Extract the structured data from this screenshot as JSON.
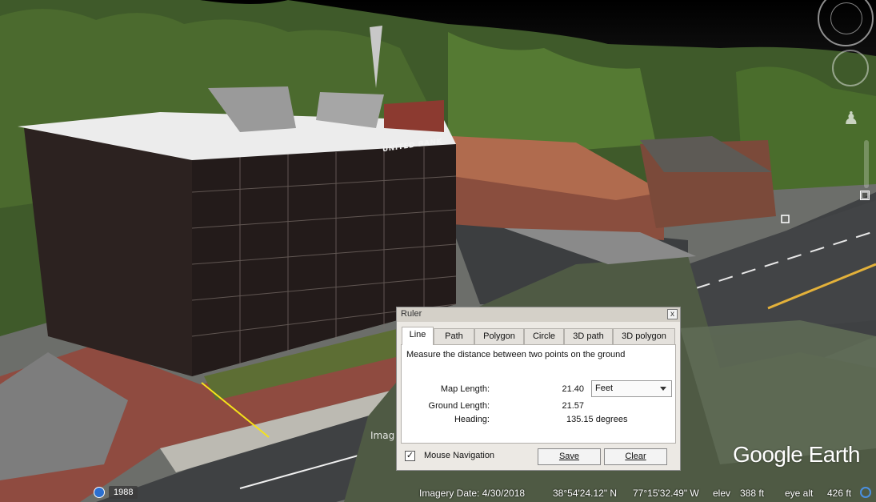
{
  "scene": {
    "building_sign": "UNITED BANK",
    "image_watermark": "Imag"
  },
  "branding": {
    "logo_text": "Google Earth"
  },
  "status_bar": {
    "year": "1988",
    "imagery_date": "Imagery Date: 4/30/2018",
    "latitude": "38°54'24.12\" N",
    "longitude": "77°15'32.49\" W",
    "elev_label": "elev",
    "elev_value": "388 ft",
    "eye_alt_label": "eye alt",
    "eye_alt_value": "426 ft"
  },
  "ruler": {
    "title": "Ruler",
    "close_label": "x",
    "tabs": [
      {
        "label": "Line",
        "active": true
      },
      {
        "label": "Path"
      },
      {
        "label": "Polygon"
      },
      {
        "label": "Circle"
      },
      {
        "label": "3D path"
      },
      {
        "label": "3D polygon"
      }
    ],
    "description": "Measure the distance between two points on the ground",
    "map_length_label": "Map Length:",
    "map_length_value": "21.40",
    "unit_selected": "Feet",
    "ground_length_label": "Ground Length:",
    "ground_length_value": "21.57",
    "heading_label": "Heading:",
    "heading_value": "135.15 degrees",
    "mouse_nav_label": "Mouse Navigation",
    "mouse_nav_checked": true,
    "checkmark": "✓",
    "save_label": "Save",
    "clear_label": "Clear"
  }
}
